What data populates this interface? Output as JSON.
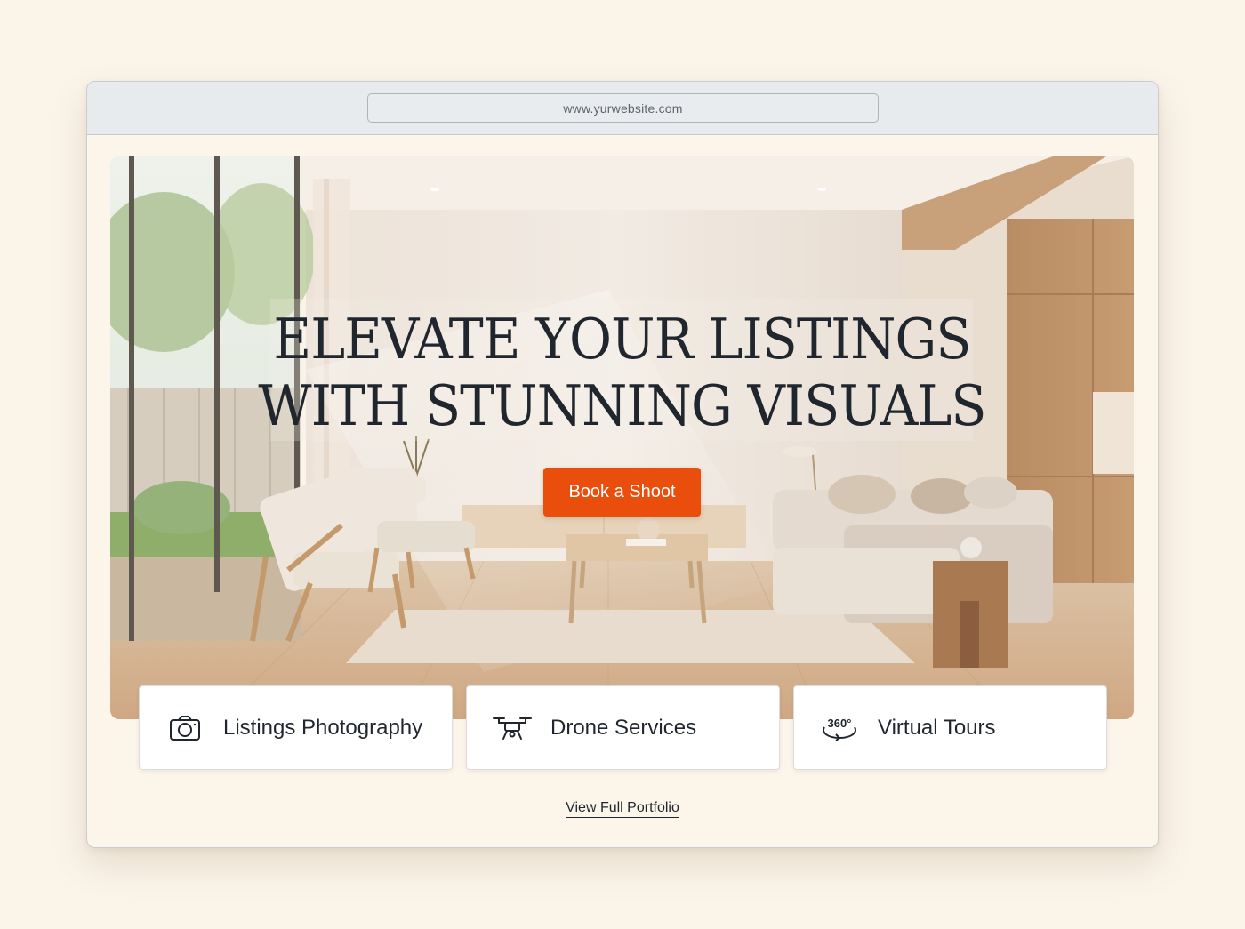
{
  "browser": {
    "url": "www.yurwebsite.com"
  },
  "hero": {
    "headline_line1": "ELEVATE YOUR LISTINGS",
    "headline_line2": "WITH STUNNING VISUALS",
    "cta_label": "Book a Shoot"
  },
  "services": [
    {
      "label": "Listings Photography",
      "icon": "camera-icon"
    },
    {
      "label": "Drone Services",
      "icon": "drone-icon"
    },
    {
      "label": "Virtual Tours",
      "icon": "360-icon",
      "icon_text": "360°"
    }
  ],
  "portfolio_link": "View Full Portfolio",
  "colors": {
    "page_background": "#fbf4e9",
    "accent": "#ea4e0c",
    "text": "#1f262d"
  }
}
